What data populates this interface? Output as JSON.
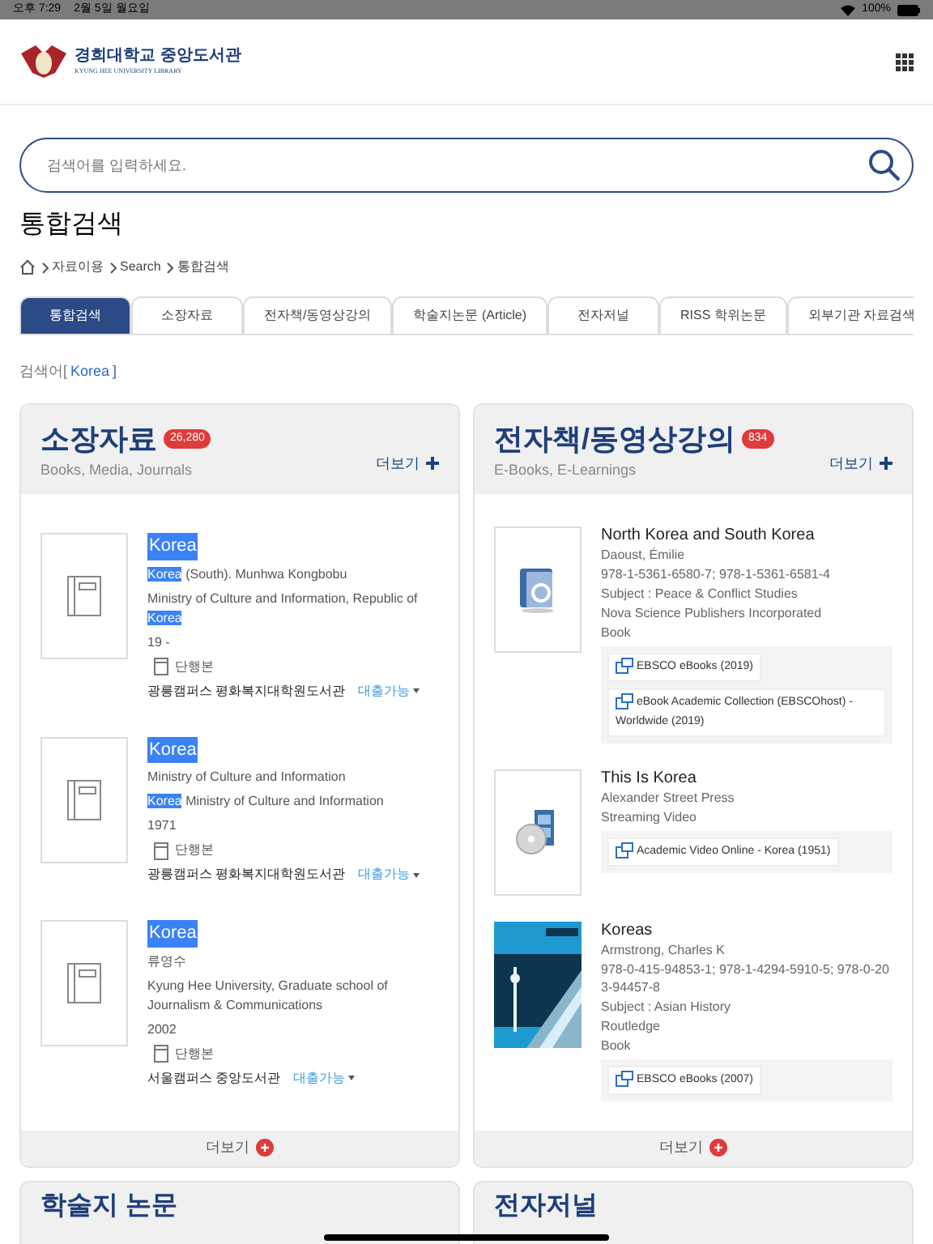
{
  "status_bar": {
    "time": "오후 7:29",
    "date": "2월 5일 월요일",
    "battery": "100%"
  },
  "logo": {
    "name": "경희대학교 중앙도서관",
    "subtitle": "KYUNG HEE UNIVERSITY LIBRARY"
  },
  "search": {
    "placeholder": "검색어를 입력하세요."
  },
  "page_title": "통합검색",
  "breadcrumb": [
    "자료이용",
    "Search",
    "통합검색"
  ],
  "tabs": [
    {
      "label": "통합검색",
      "selected": true
    },
    {
      "label": "소장자료",
      "selected": false
    },
    {
      "label": "전자책/동영상강의",
      "selected": false
    },
    {
      "label": "학술지논문 (Article)",
      "selected": false
    },
    {
      "label": "전자저널",
      "selected": false
    },
    {
      "label": "RISS 학위논문",
      "selected": false
    },
    {
      "label": "외부기관 자료검색",
      "selected": false
    }
  ],
  "query": {
    "label": "검색어",
    "open": "[",
    "term": "Korea",
    "close": "]"
  },
  "holdings": {
    "title": "소장자료",
    "count": "26,280",
    "subtitle": "Books, Media, Journals",
    "more": "더보기",
    "footer_more": "더보기",
    "items": [
      {
        "title": "Korea",
        "lines": [
          [
            {
              "text": "Korea",
              "highlight": true
            },
            {
              "text": " (South). Munhwa Kongbobu",
              "highlight": false
            }
          ],
          [
            {
              "text": "Ministry of Culture and Information, Republic of ",
              "highlight": false
            },
            {
              "text": "Korea",
              "highlight": true
            }
          ]
        ],
        "year": "19 -",
        "type": "단행본",
        "location": "광릉캠퍼스 평화복지대학원도서관",
        "status": "대출가능"
      },
      {
        "title": "Korea",
        "lines": [
          [
            {
              "text": "Ministry of Culture and Information",
              "highlight": false
            }
          ],
          [
            {
              "text": "Korea",
              "highlight": true
            },
            {
              "text": " Ministry of Culture and Information",
              "highlight": false
            }
          ]
        ],
        "year": "1971",
        "type": "단행본",
        "location": "광릉캠퍼스 평화복지대학원도서관",
        "status": "대출가능"
      },
      {
        "title": "Korea",
        "lines": [
          [
            {
              "text": "류영수",
              "highlight": false
            }
          ],
          [
            {
              "text": "Kyung Hee University, Graduate school of Journalism & Communications",
              "highlight": false
            }
          ]
        ],
        "year": "2002",
        "type": "단행본",
        "location": "서울캠퍼스 중앙도서관",
        "status": "대출가능"
      }
    ]
  },
  "ebooks": {
    "title": "전자책/동영상강의",
    "count": "834",
    "subtitle": "E-Books, E-Learnings",
    "more": "더보기",
    "footer_more": "더보기",
    "items": [
      {
        "kind": "ebook",
        "title": "North Korea and South Korea",
        "lines": [
          "Daoust, Émilie",
          "978-1-5361-6580-7; 978-1-5361-6581-4",
          "Subject : Peace & Conflict Studies",
          "Nova Science Publishers Incorporated",
          "Book"
        ],
        "links": [
          "EBSCO eBooks (2019)",
          "eBook Academic Collection (EBSCOhost) - Worldwide (2019)"
        ]
      },
      {
        "kind": "video",
        "title": "This Is Korea",
        "lines": [
          "Alexander Street Press",
          "Streaming Video"
        ],
        "links": [
          "Academic Video Online - Korea (1951)"
        ]
      },
      {
        "kind": "picture",
        "title": "Koreas",
        "lines": [
          "Armstrong, Charles K",
          "978-0-415-94853-1; 978-1-4294-5910-5; 978-0-203-94457-8",
          "Subject : Asian History",
          "Routledge",
          "Book"
        ],
        "links": [
          "EBSCO eBooks (2007)"
        ]
      }
    ]
  },
  "next_sections": [
    {
      "title": "학술지 논문"
    },
    {
      "title": "전자저널"
    }
  ]
}
